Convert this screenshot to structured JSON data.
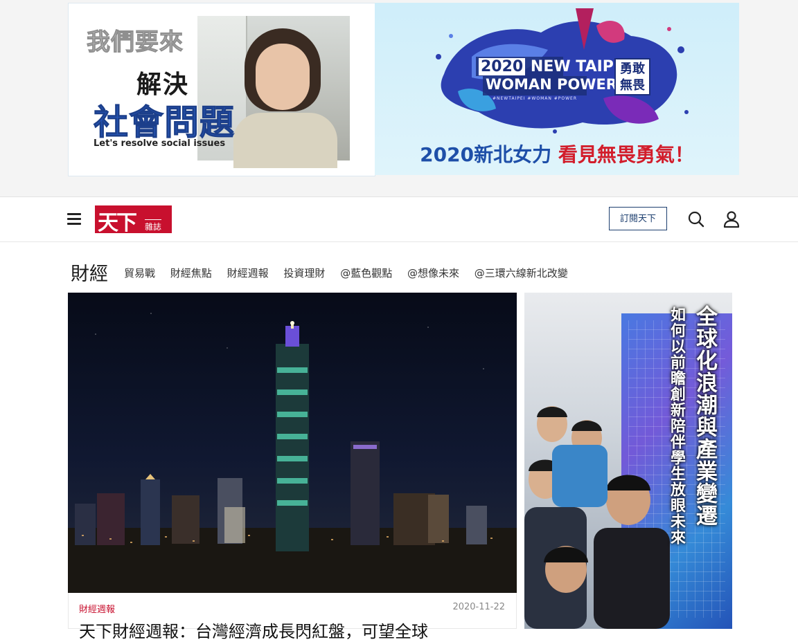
{
  "ads": {
    "left": {
      "line1": "我們要來",
      "line2": "解決",
      "line3": "社會問題",
      "english": "Let's resolve social issues"
    },
    "right": {
      "year_tag": "2020",
      "title_line1": "NEW TAIPEI",
      "title_line2": "WOMAN POWER",
      "badge": "勇敢無畏",
      "hashtags": "#NEWTAIPEI   #WOMAN   #POWER",
      "slogan_blue": "2020新北女力",
      "slogan_red": "看見無畏勇氣！"
    }
  },
  "header": {
    "logo_text_big": "天下",
    "logo_text_small": "雜誌",
    "subscribe_label": "訂閱天下",
    "icons": [
      "menu-icon",
      "search-icon",
      "user-icon"
    ]
  },
  "category": {
    "title": "財經",
    "links": [
      "貿易戰",
      "財經焦點",
      "財經週報",
      "投資理財",
      "@藍色觀點",
      "@想像未來",
      "@三環六線新北改變"
    ]
  },
  "feature": {
    "tag": "財經週報",
    "date": "2020-11-22",
    "headline": "天下財經週報：台灣經濟成長閃紅盤，可望全球"
  },
  "side_ad": {
    "vertical_main": "全球化浪潮與產業變遷",
    "vertical_sub": "如何以前瞻創新陪伴學生放眼未來"
  },
  "colors": {
    "brand_red": "#c8102e",
    "navy": "#1c3e6e"
  }
}
